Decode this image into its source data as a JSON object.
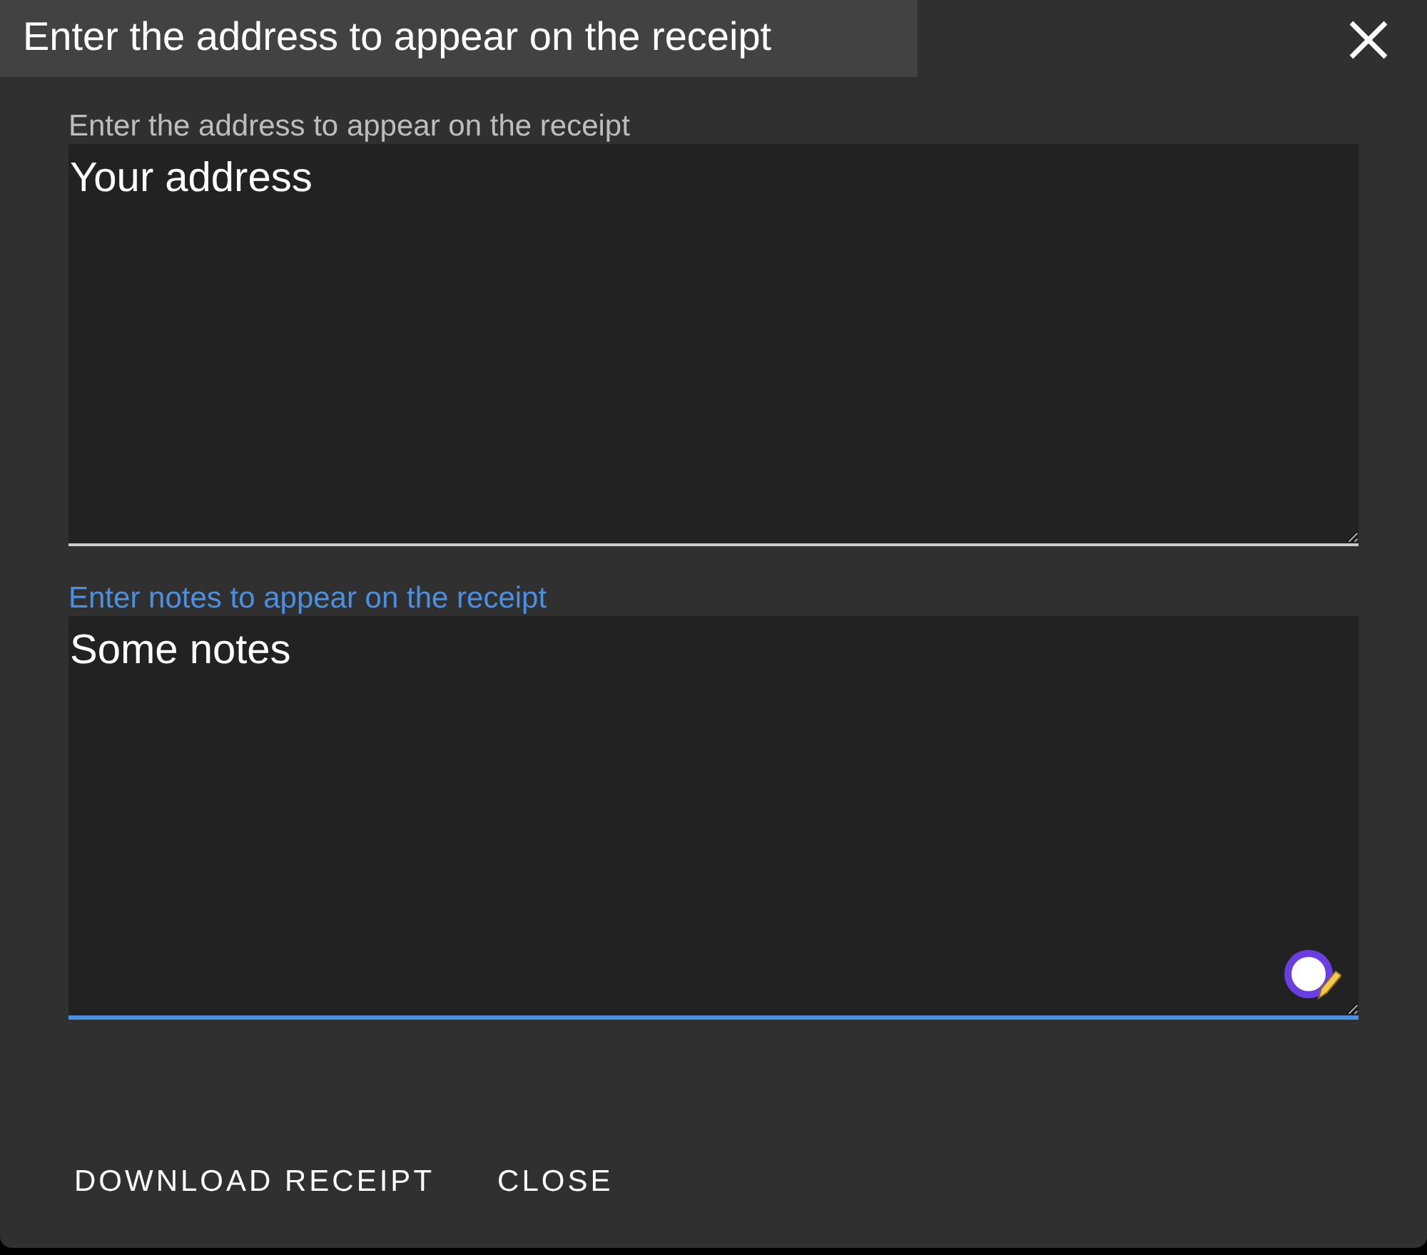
{
  "dialog": {
    "title": "Enter the address to appear on the receipt"
  },
  "fields": [
    {
      "label": "Enter the address to appear on the receipt",
      "value": "Your address",
      "focused": false
    },
    {
      "label": "Enter notes to appear on the receipt",
      "value": "Some notes",
      "focused": true
    }
  ],
  "buttons": [
    "DOWNLOAD RECEIPT",
    "CLOSE"
  ]
}
